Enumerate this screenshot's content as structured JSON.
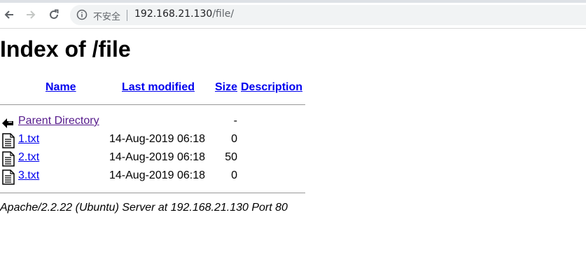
{
  "browser": {
    "security_label": "不安全",
    "url_host": "192.168.21.130",
    "url_path": "/file/"
  },
  "page": {
    "title": "Index of /file",
    "columns": {
      "name": "Name",
      "last_modified": "Last modified",
      "size": "Size",
      "description": "Description"
    },
    "parent": {
      "label": "Parent Directory",
      "size": "-"
    },
    "files": [
      {
        "name": "1.txt",
        "modified": "14-Aug-2019 06:18",
        "size": "0"
      },
      {
        "name": "2.txt",
        "modified": "14-Aug-2019 06:18",
        "size": "50"
      },
      {
        "name": "3.txt",
        "modified": "14-Aug-2019 06:18",
        "size": "0"
      }
    ],
    "footer": "Apache/2.2.22 (Ubuntu) Server at 192.168.21.130 Port 80"
  },
  "colors": {
    "link": "#0000ee",
    "visited": "#551a8b",
    "rule": "#999999"
  }
}
